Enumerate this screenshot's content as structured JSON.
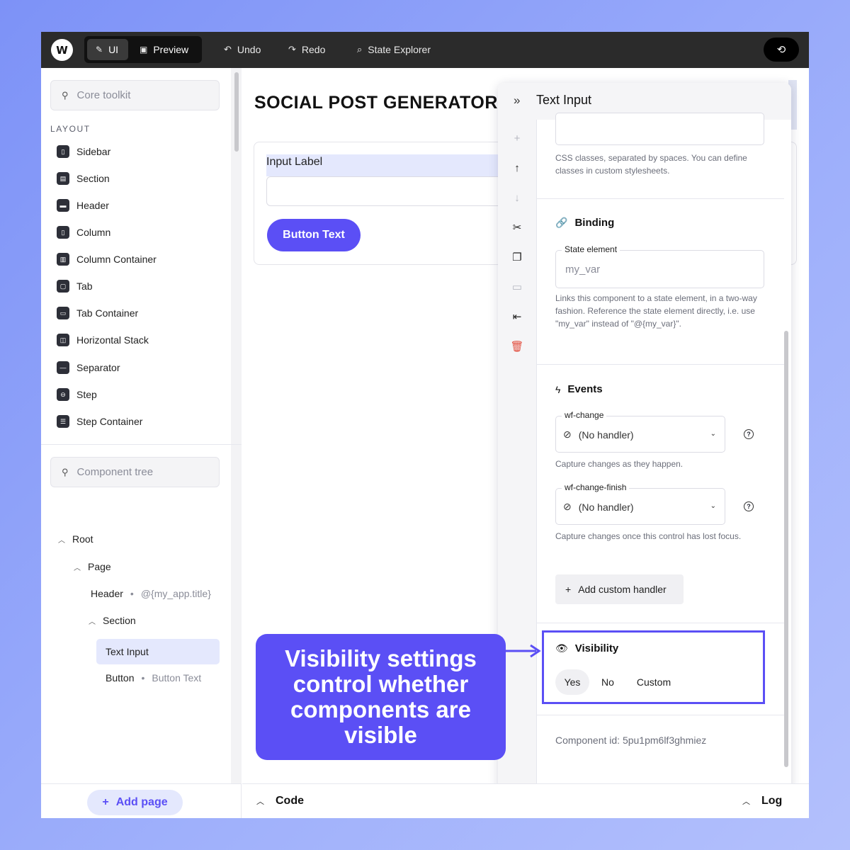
{
  "topbar": {
    "logo": "W",
    "modes": [
      {
        "label": "UI",
        "icon": "pencil-icon",
        "active": true
      },
      {
        "label": "Preview",
        "icon": "preview-icon",
        "active": false
      }
    ],
    "undo": "Undo",
    "redo": "Redo",
    "state_explorer": "State Explorer",
    "right_icon": "sync-icon"
  },
  "sidebar": {
    "toolkit_search": "Core toolkit",
    "section_label": "LAYOUT",
    "toolkit_items": [
      "Sidebar",
      "Section",
      "Header",
      "Column",
      "Column Container",
      "Tab",
      "Tab Container",
      "Horizontal Stack",
      "Separator",
      "Step",
      "Step Container"
    ],
    "tree_search": "Component tree",
    "tree": {
      "root": "Root",
      "page": "Page",
      "header": "Header",
      "header_meta": "@{my_app.title}",
      "section": "Section",
      "text_input": "Text Input",
      "button": "Button",
      "button_meta": "Button Text"
    },
    "add_page": "Add page"
  },
  "canvas": {
    "title": "SOCIAL POST GENERATOR",
    "input_label": "Input Label",
    "button_text": "Button Text"
  },
  "panel": {
    "title": "Text Input",
    "classes_help": "CSS classes, separated by spaces. You can define classes in custom stylesheets.",
    "binding": {
      "heading": "Binding",
      "field_label": "State element",
      "placeholder": "my_var",
      "help": "Links this component to a state element, in a two-way fashion. Reference the state element directly, i.e. use \"my_var\" instead of \"@{my_var}\"."
    },
    "events": {
      "heading": "Events",
      "items": [
        {
          "label": "wf-change",
          "value": "(No handler)",
          "help": "Capture changes as they happen."
        },
        {
          "label": "wf-change-finish",
          "value": "(No handler)",
          "help": "Capture changes once this control has lost focus."
        }
      ],
      "add_handler": "Add custom handler"
    },
    "visibility": {
      "heading": "Visibility",
      "options": [
        "Yes",
        "No",
        "Custom"
      ],
      "selected": "Yes"
    },
    "component_id": "Component id: 5pu1pm6lf3ghmiez"
  },
  "bottombar": {
    "code": "Code",
    "log": "Log"
  },
  "callout": {
    "text": "Visibility settings control whether components are visible"
  },
  "colors": {
    "accent": "#5b4ff5",
    "accent_light": "#e4e8fd",
    "danger": "#e24b3b",
    "topbar": "#2b2b2b"
  }
}
